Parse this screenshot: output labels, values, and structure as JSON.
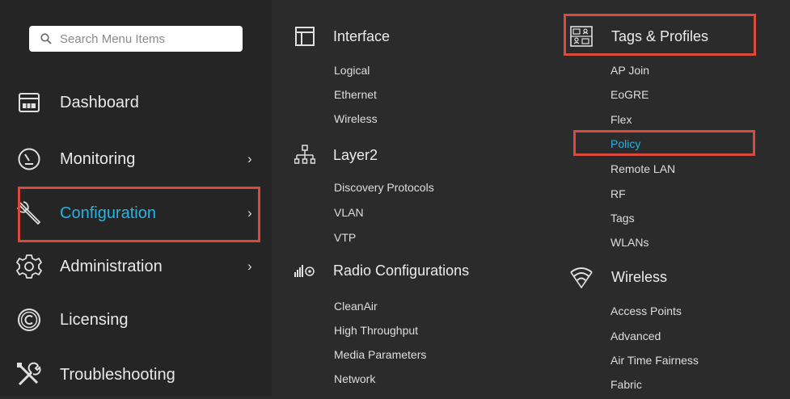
{
  "search": {
    "placeholder": "Search Menu Items"
  },
  "sidebar": {
    "items": [
      {
        "label": "Dashboard",
        "chevron": ""
      },
      {
        "label": "Monitoring",
        "chevron": "›"
      },
      {
        "label": "Configuration",
        "chevron": "›"
      },
      {
        "label": "Administration",
        "chevron": "›"
      },
      {
        "label": "Licensing",
        "chevron": ""
      },
      {
        "label": "Troubleshooting",
        "chevron": ""
      }
    ]
  },
  "columns": {
    "interface": {
      "title": "Interface",
      "items": [
        "Logical",
        "Ethernet",
        "Wireless"
      ]
    },
    "layer2": {
      "title": "Layer2",
      "items": [
        "Discovery Protocols",
        "VLAN",
        "VTP"
      ]
    },
    "radio": {
      "title": "Radio Configurations",
      "items": [
        "CleanAir",
        "High Throughput",
        "Media Parameters",
        "Network"
      ]
    },
    "tags": {
      "title": "Tags & Profiles",
      "items": [
        "AP Join",
        "EoGRE",
        "Flex",
        "Policy",
        "Remote LAN",
        "RF",
        "Tags",
        "WLANs"
      ]
    },
    "wireless": {
      "title": "Wireless",
      "items": [
        "Access Points",
        "Advanced",
        "Air Time Fairness",
        "Fabric"
      ]
    }
  },
  "colors": {
    "accent": "#25b3e6",
    "highlight": "#d94a3d",
    "background": "#2b2b2b"
  }
}
